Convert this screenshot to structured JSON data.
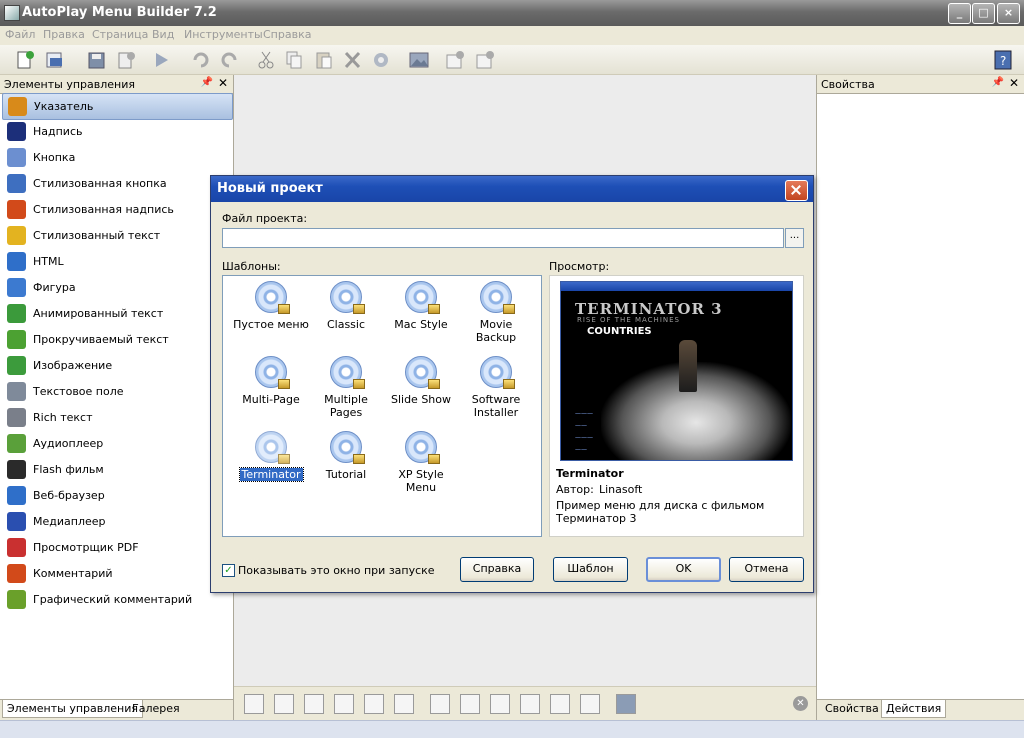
{
  "window": {
    "title": "AutoPlay Menu Builder 7.2",
    "controls": [
      "_",
      "□",
      "×"
    ]
  },
  "menubar": [
    "Файл",
    "Правка",
    "Страница",
    "Вид",
    "Инструменты",
    "Справка"
  ],
  "toolbar": {
    "icons": [
      "new-file-icon",
      "open-file-icon",
      "save-icon",
      "close-doc-icon",
      "play-icon",
      "undo-icon",
      "redo-icon",
      "cut-icon",
      "copy-icon",
      "paste-icon",
      "delete-icon",
      "properties-icon",
      "image-icon",
      "add-page-icon",
      "remove-page-icon",
      "help-icon"
    ]
  },
  "left_panel": {
    "title": "Элементы управления",
    "items": [
      {
        "label": "Указатель",
        "icon": "pointer-icon",
        "color": "#d88a1a"
      },
      {
        "label": "Надпись",
        "icon": "label-a-icon",
        "color": "#1c2f7a"
      },
      {
        "label": "Кнопка",
        "icon": "button-ok-icon",
        "color": "#6c8fd0"
      },
      {
        "label": "Стилизованная кнопка",
        "icon": "styled-button-icon",
        "color": "#3e6fc0"
      },
      {
        "label": "Стилизованная надпись",
        "icon": "styled-label-icon",
        "color": "#d24a1a"
      },
      {
        "label": "Стилизованный текст",
        "icon": "cool-text-icon",
        "color": "#e3b320"
      },
      {
        "label": "HTML",
        "icon": "html-globe-icon",
        "color": "#2f6fc9"
      },
      {
        "label": "Фигура",
        "icon": "shape-icon",
        "color": "#3c7ad0"
      },
      {
        "label": "Анимированный текст",
        "icon": "animated-text-icon",
        "color": "#3b9a3b"
      },
      {
        "label": "Прокручиваемый текст",
        "icon": "scroll-text-icon",
        "color": "#4ca132"
      },
      {
        "label": "Изображение",
        "icon": "image-icon",
        "color": "#3c9b3c"
      },
      {
        "label": "Текстовое поле",
        "icon": "text-field-icon",
        "color": "#7f8a9a"
      },
      {
        "label": "Rich текст",
        "icon": "rich-text-icon",
        "color": "#7a7f8a"
      },
      {
        "label": "Аудиоплеер",
        "icon": "audio-icon",
        "color": "#5aa03a"
      },
      {
        "label": "Flash фильм",
        "icon": "flash-icon",
        "color": "#2a2a2a"
      },
      {
        "label": "Веб-браузер",
        "icon": "web-browser-icon",
        "color": "#2f6fc9"
      },
      {
        "label": "Медиаплеер",
        "icon": "media-player-icon",
        "color": "#2a4fb0"
      },
      {
        "label": "Просмотрщик PDF",
        "icon": "pdf-icon",
        "color": "#c93030"
      },
      {
        "label": "Комментарий",
        "icon": "comment-icon",
        "color": "#d24a1a"
      },
      {
        "label": "Графический комментарий",
        "icon": "graphic-comment-icon",
        "color": "#6aa02a"
      }
    ],
    "tabs": [
      "Элементы управления",
      "Галерея"
    ]
  },
  "right_panel": {
    "title": "Свойства",
    "tabs": [
      "Свойства",
      "Действия"
    ]
  },
  "dialog": {
    "title": "Новый проект",
    "file_label": "Файл проекта:",
    "file_value": "",
    "browse_label": "...",
    "templates_label": "Шаблоны:",
    "preview_label": "Просмотр:",
    "templates": [
      {
        "name": "Пустое меню"
      },
      {
        "name": "Classic"
      },
      {
        "name": "Mac Style"
      },
      {
        "name": "Movie Backup"
      },
      {
        "name": "Multi-Page"
      },
      {
        "name": "Multiple Pages"
      },
      {
        "name": "Slide Show"
      },
      {
        "name": "Software Installer"
      },
      {
        "name": "Terminator",
        "selected": true
      },
      {
        "name": "Tutorial"
      },
      {
        "name": "XP Style Menu"
      }
    ],
    "preview": {
      "image_title": "TERMINATOR 3",
      "image_subtitle": "RISE OF THE MACHINES",
      "image_caption": "COUNTRIES",
      "name": "Terminator",
      "author_label": "Автор:",
      "author": "Linasoft",
      "description": "Пример меню для диска с фильмом Терминатор 3"
    },
    "show_on_start": {
      "label": "Показывать это окно при запуске",
      "checked": true
    },
    "buttons": {
      "help": "Справка",
      "template": "Шаблон",
      "ok": "OK",
      "cancel": "Отмена"
    }
  },
  "colors": {
    "title_bar": "#6b6b6b",
    "dialog_title": "#1e4fb6",
    "selection": "#316ac5",
    "background": "#ece9d8"
  }
}
